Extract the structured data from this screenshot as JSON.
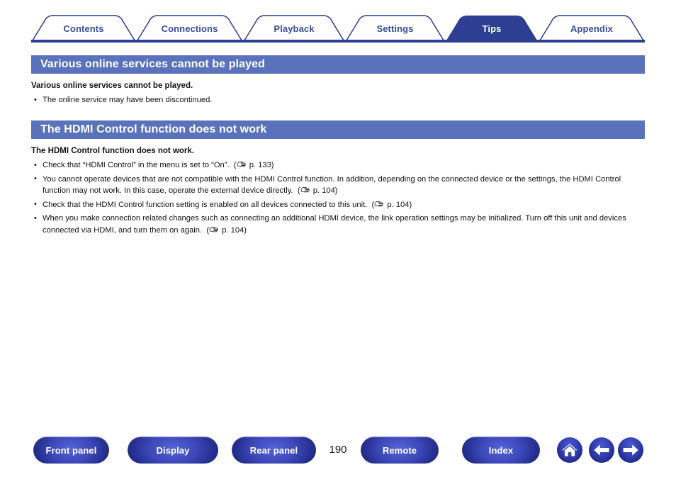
{
  "tabs": [
    {
      "label": "Contents",
      "active": false
    },
    {
      "label": "Connections",
      "active": false
    },
    {
      "label": "Playback",
      "active": false
    },
    {
      "label": "Settings",
      "active": false
    },
    {
      "label": "Tips",
      "active": true
    },
    {
      "label": "Appendix",
      "active": false
    }
  ],
  "sections": [
    {
      "header": "Various online services cannot be played",
      "subhead": "Various online services cannot be played.",
      "bullets": [
        {
          "text": "The online service may have been discontinued.",
          "page_ref": ""
        }
      ]
    },
    {
      "header": "The HDMI Control function does not work",
      "subhead": "The HDMI Control function does not work.",
      "bullets": [
        {
          "text": "Check that “HDMI Control” in the menu is set to “On”.",
          "page_ref": "p. 133"
        },
        {
          "text": "You cannot operate devices that are not compatible with the HDMI Control function. In addition, depending on the connected device or the settings, the HDMI Control function may not work. In this case, operate the external device directly.",
          "page_ref": "p. 104"
        },
        {
          "text": "Check that the HDMI Control function setting is enabled on all devices connected to this unit.",
          "page_ref": "p. 104"
        },
        {
          "text": "When you make connection related changes such as connecting an additional HDMI device, the link operation settings may be initialized. Turn off this unit and devices connected via HDMI, and turn them on again.",
          "page_ref": "p. 104"
        }
      ]
    }
  ],
  "footer": {
    "buttons": [
      {
        "label": "Front panel"
      },
      {
        "label": "Display"
      },
      {
        "label": "Rear panel"
      },
      {
        "label": "Remote"
      },
      {
        "label": "Index"
      }
    ],
    "page_number": "190",
    "icon_buttons": [
      {
        "icon": "home-icon"
      },
      {
        "icon": "arrow-left-icon"
      },
      {
        "icon": "arrow-right-icon"
      }
    ]
  },
  "colors": {
    "tab_active_bg": "#2e3e92",
    "tab_inactive_text": "#3b4ea0",
    "section_header_bg": "#5a72bb",
    "baseline": "#2e3e92",
    "button_blue": "#2a34a0"
  }
}
